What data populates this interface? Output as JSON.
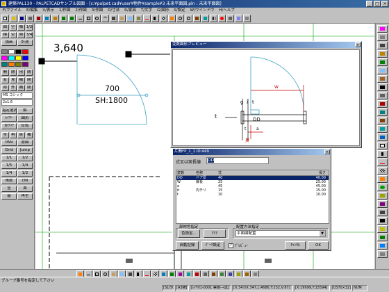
{
  "window": {
    "title": "建築PAL130 - PALPETCADサンプル図面 - [c:¥palpet.cad¥user¥物件¥sample¥3 未来平面図.pln : 未来平面図]",
    "controls": [
      "_",
      "□",
      "×"
    ]
  },
  "menu": [
    "F/ファイル",
    "E/編集",
    "V/表示",
    "1/作図",
    "2/作図",
    "3/作図",
    "D/寸法",
    "R/家具",
    "T/文字",
    "G/図形",
    "S/設定",
    "W/ウインドウ",
    "H/ヘルプ"
  ],
  "left_panel": {
    "row1": [
      "図",
      "空",
      "補",
      "1/2"
    ],
    "row2": [
      "標",
      "空",
      "閉",
      "3/4"
    ],
    "row3": [
      "描画",
      "計測"
    ],
    "colors_row1": [
      "#808080",
      "#ffffff",
      "#000000",
      "#ff0000",
      "#00a000"
    ],
    "colors_row2": [
      "#ff00ff",
      "#00ffff",
      "#ffff00",
      "#0000ff",
      "#800000"
    ],
    "colors_row3": [
      "#008080",
      "#ff8000",
      "#808000",
      "#800080",
      "#004080"
    ],
    "mode_row1": [
      "開",
      "閉",
      "用",
      "閉"
    ],
    "mode_row2": [
      "変",
      "見",
      "補",
      "閉"
    ],
    "mode_row3": [
      "部",
      "外",
      "補",
      "閉"
    ],
    "font_combo": "MS ゴシック",
    "size_combo": "2x1.6",
    "buttons_a": [
      "指定選択",
      "解"
    ],
    "buttons_b": [
      "ﾚｲﾔｰ",
      "図形"
    ],
    "buttons_c": [
      "全ｸﾘｱ",
      "反転"
    ],
    "buttons_d": [
      "全",
      "再",
      "戻",
      "補"
    ],
    "buttons_e": [
      "PAN",
      "原図"
    ],
    "buttons_f": [
      "Grid",
      "Jump"
    ],
    "scales": [
      "1/1",
      "1/2"
    ],
    "scales2": [
      "1/5",
      "1/4"
    ],
    "scales3": [
      "1/4",
      "1/2"
    ],
    "buttons_g": [
      "角度",
      "ON"
    ],
    "buttons_h": [
      "全",
      "周"
    ],
    "buttons_i": [
      "基",
      "再生"
    ]
  },
  "drawing": {
    "dim_text": "3,640",
    "room_width": "700",
    "room_height": "SH:1800"
  },
  "preview": {
    "title": "変数図形プレビュー",
    "labels": [
      "W",
      "g",
      "i",
      "t",
      "t",
      "DD",
      "a",
      "t",
      "奥"
    ]
  },
  "dialog": {
    "title": "片開FP_1_1 ID:449",
    "formula_label": "式又は実長値",
    "formula_value": "DD",
    "columns": [
      "変数",
      "名称",
      "式",
      "長さ"
    ],
    "rows": [
      [
        "DD",
        "ドア厚",
        "40",
        "40.00"
      ],
      [
        "W",
        "扉長",
        "25",
        "25.00"
      ],
      [
        "a",
        "",
        "45",
        "45.00"
      ],
      [
        "it",
        "内チリ",
        "15",
        "15.00"
      ],
      [
        "t",
        "",
        "10",
        "10.00"
      ]
    ],
    "section_color": "部材色指定",
    "color_btn": "色設定...",
    "clear_btn": "ｸﾘｱ",
    "section_place": "配置方法指定",
    "place_select": "平面図配置",
    "auto_record": "自動記録",
    "part_settings": "ﾊﾟｰﾂ設定",
    "preview_check": "ﾌﾟﾚﾋﾞｭｰ",
    "cancel": "ｷｬﾝｾﾙ",
    "ok": "OK"
  },
  "status": {
    "message": "グループ番号を指定して下さい",
    "cells": [
      "[S1/50]",
      "[A3横]",
      "[ﾚｲﾔ01-0001 実線-→黒]",
      "[X:347/X:347,L:4686,T:232,V:87]",
      "[X:19999,Y:15594]",
      "[0370×32]",
      "NUM"
    ]
  }
}
